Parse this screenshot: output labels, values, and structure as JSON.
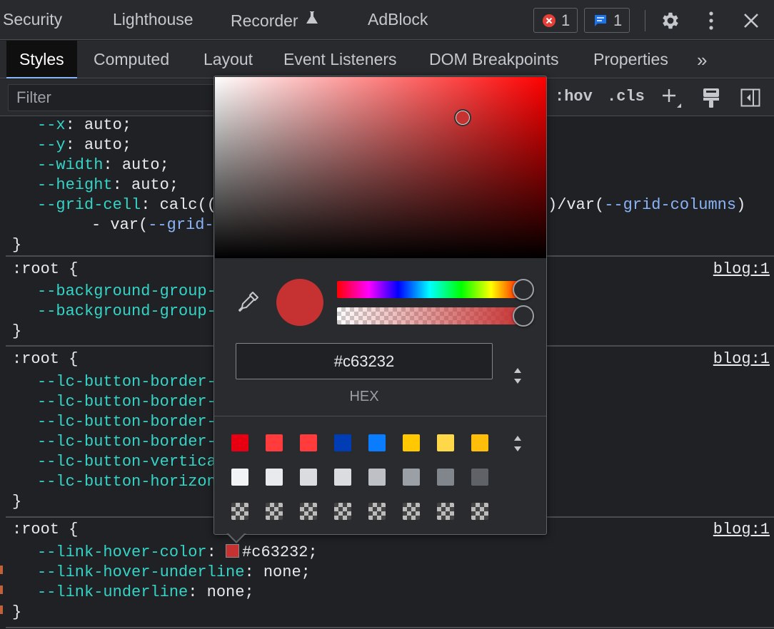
{
  "top_tabs": [
    "Security",
    "Lighthouse",
    "Recorder",
    "AdBlock"
  ],
  "badges": {
    "errors": "1",
    "messages": "1"
  },
  "sub_tabs": [
    "Styles",
    "Computed",
    "Layout",
    "Event Listeners",
    "DOM Breakpoints",
    "Properties"
  ],
  "more_tabs": "»",
  "filter": {
    "placeholder": "Filter",
    "hov": ":hov",
    "cls": ".cls"
  },
  "code": {
    "block1": {
      "lines": [
        {
          "prop": "--x",
          "value": "auto;"
        },
        {
          "prop": "--y",
          "value": "auto;"
        },
        {
          "prop": "--width",
          "value": "auto;"
        },
        {
          "prop": "--height",
          "value": "auto;"
        }
      ],
      "grid_cell_prop": "--grid-cell",
      "grid_cell_start": "calc((",
      "grid_cell_end": ")/var(",
      "grid_columns": "--grid-columns",
      "grid_cell_close": ")",
      "cont_prefix": "- var(",
      "cont_var": "--grid-",
      "close": "}"
    },
    "block2": {
      "selector": ":root {",
      "source": "blog:1",
      "props": [
        "--background-group-",
        "--background-group-"
      ],
      "close": "}"
    },
    "block3": {
      "selector": ":root {",
      "source": "blog:1",
      "props": [
        "--lc-button-border-",
        "--lc-button-border-",
        "--lc-button-border-",
        "--lc-button-border-",
        "--lc-button-vertica",
        "--lc-button-horizon"
      ],
      "close": "}"
    },
    "block4": {
      "selector": ":root {",
      "source": "blog:1",
      "lines": [
        {
          "prop": "--link-hover-color",
          "value": "#c63232;"
        },
        {
          "prop": "--link-hover-underline",
          "value": "none;"
        },
        {
          "prop": "--link-underline",
          "value": "none;"
        }
      ],
      "close": "}"
    }
  },
  "color_picker": {
    "color": "#c63232",
    "hex_value": "#c63232",
    "format_label": "HEX",
    "palette": [
      [
        "#e60012",
        "#ff3b3b",
        "#ff3b3b",
        "#003cb4",
        "#0a7cff",
        "#ffc800",
        "#ffd84a",
        "#ffbe0a"
      ],
      [
        "#f1f3f4",
        "#e8eaed",
        "#dadce0",
        "#dadce0",
        "#bdc1c6",
        "#9aa0a6",
        "#80868b",
        "#5f6368"
      ]
    ]
  },
  "colors": {
    "accent_blue": "#8ab4f8",
    "property_teal": "#35d4c7",
    "error_red": "#e63f37",
    "message_blue": "#1a73e8"
  }
}
